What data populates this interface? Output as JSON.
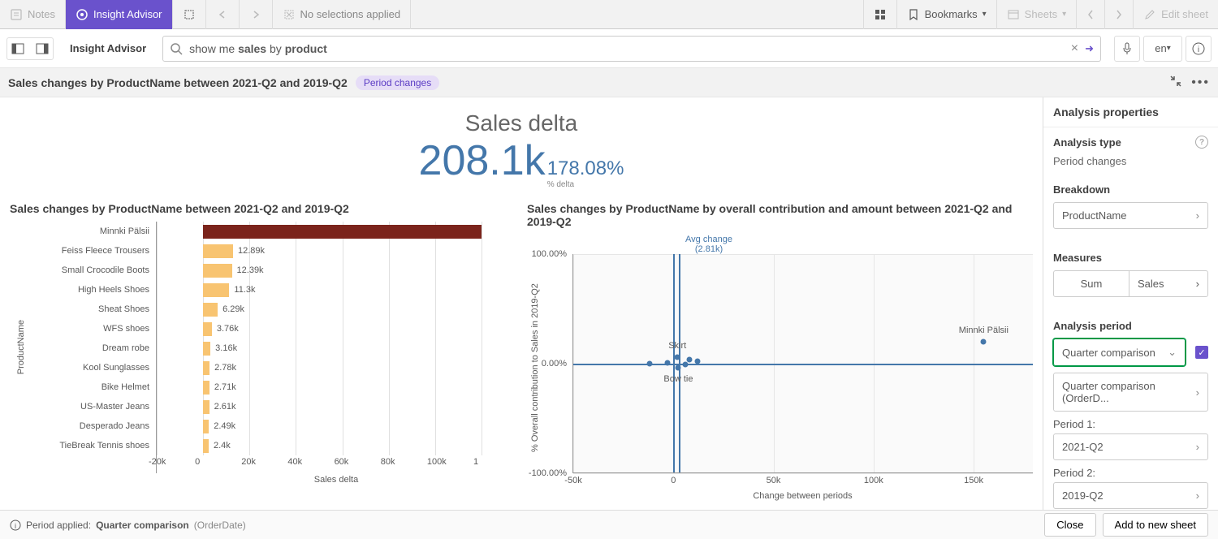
{
  "toolbar": {
    "notes": "Notes",
    "insight_advisor": "Insight Advisor",
    "no_selections": "No selections applied",
    "bookmarks": "Bookmarks",
    "sheets": "Sheets",
    "edit_sheet": "Edit sheet"
  },
  "subtoolbar": {
    "label": "Insight Advisor",
    "search_value": "show me sales by product",
    "lang": "en"
  },
  "titlebar": {
    "title": "Sales changes by ProductName between 2021-Q2 and 2019-Q2",
    "badge": "Period changes"
  },
  "kpi": {
    "title": "Sales delta",
    "value": "208.1k",
    "pct": "178.08%",
    "pct_label": "% delta"
  },
  "chart_data": [
    {
      "type": "bar",
      "title": "Sales changes by ProductName between 2021-Q2 and 2019-Q2",
      "ylabel": "ProductName",
      "xlabel": "Sales delta",
      "categories": [
        "Minnki Pälsii",
        "Feiss Fleece Trousers",
        "Small Crocodile Boots",
        "High Heels Shoes",
        "Sheat Shoes",
        "WFS shoes",
        "Dream robe",
        "Kool Sunglasses",
        "Bike Helmet",
        "US-Master Jeans",
        "Desperado Jeans",
        "TieBreak Tennis shoes"
      ],
      "values": [
        120000,
        12890,
        12390,
        11300,
        6290,
        3760,
        3160,
        2780,
        2710,
        2610,
        2490,
        2400
      ],
      "value_labels": [
        "",
        "12.89k",
        "12.39k",
        "11.3k",
        "6.29k",
        "3.76k",
        "3.16k",
        "2.78k",
        "2.71k",
        "2.61k",
        "2.49k",
        "2.4k"
      ],
      "x_ticks": [
        "-20k",
        "0",
        "20k",
        "40k",
        "60k",
        "80k",
        "100k",
        "1"
      ],
      "xlim": [
        -20000,
        120000
      ]
    },
    {
      "type": "scatter",
      "title": "Sales changes by ProductName by overall contribution and amount between 2021-Q2 and 2019-Q2",
      "xlabel": "Change between periods",
      "ylabel": "% Overall contribution to Sales in 2019-Q2",
      "avg_label": "Avg change",
      "avg_value": "(2.81k)",
      "avg_x": 2810,
      "xlim": [
        -50000,
        180000
      ],
      "ylim": [
        -100,
        100
      ],
      "x_ticks": [
        "-50k",
        "0",
        "50k",
        "100k",
        "150k"
      ],
      "y_ticks": [
        "100.00%",
        "0.00%",
        "-100.00%"
      ],
      "points": [
        {
          "label": "Minnki Pälsii",
          "x": 155000,
          "y": 20
        },
        {
          "label": "Skirt",
          "x": 2000,
          "y": 6,
          "show_label": true,
          "label_y_offset": -14
        },
        {
          "label": "Bow tie",
          "x": 2500,
          "y": -4,
          "show_label": true,
          "label_y_offset": 14
        },
        {
          "label": "",
          "x": -12000,
          "y": 0
        },
        {
          "label": "",
          "x": 6000,
          "y": -1
        },
        {
          "label": "",
          "x": 12000,
          "y": 2
        },
        {
          "label": "",
          "x": 8000,
          "y": 4
        },
        {
          "label": "",
          "x": -3000,
          "y": 1
        }
      ]
    }
  ],
  "sidepanel": {
    "header": "Analysis properties",
    "analysis_type_title": "Analysis type",
    "analysis_type_value": "Period changes",
    "breakdown_title": "Breakdown",
    "breakdown_value": "ProductName",
    "measures_title": "Measures",
    "measure_agg": "Sum",
    "measure_field": "Sales",
    "period_title": "Analysis period",
    "period_comparison": "Quarter comparison",
    "period_field": "Quarter comparison (OrderD...",
    "period1_label": "Period 1:",
    "period1_value": "2021-Q2",
    "period2_label": "Period 2:",
    "period2_value": "2019-Q2"
  },
  "footer": {
    "period_applied_label": "Period applied:",
    "period_applied_bold": "Quarter comparison",
    "period_applied_paren": "(OrderDate)",
    "close": "Close",
    "add": "Add to new sheet"
  }
}
